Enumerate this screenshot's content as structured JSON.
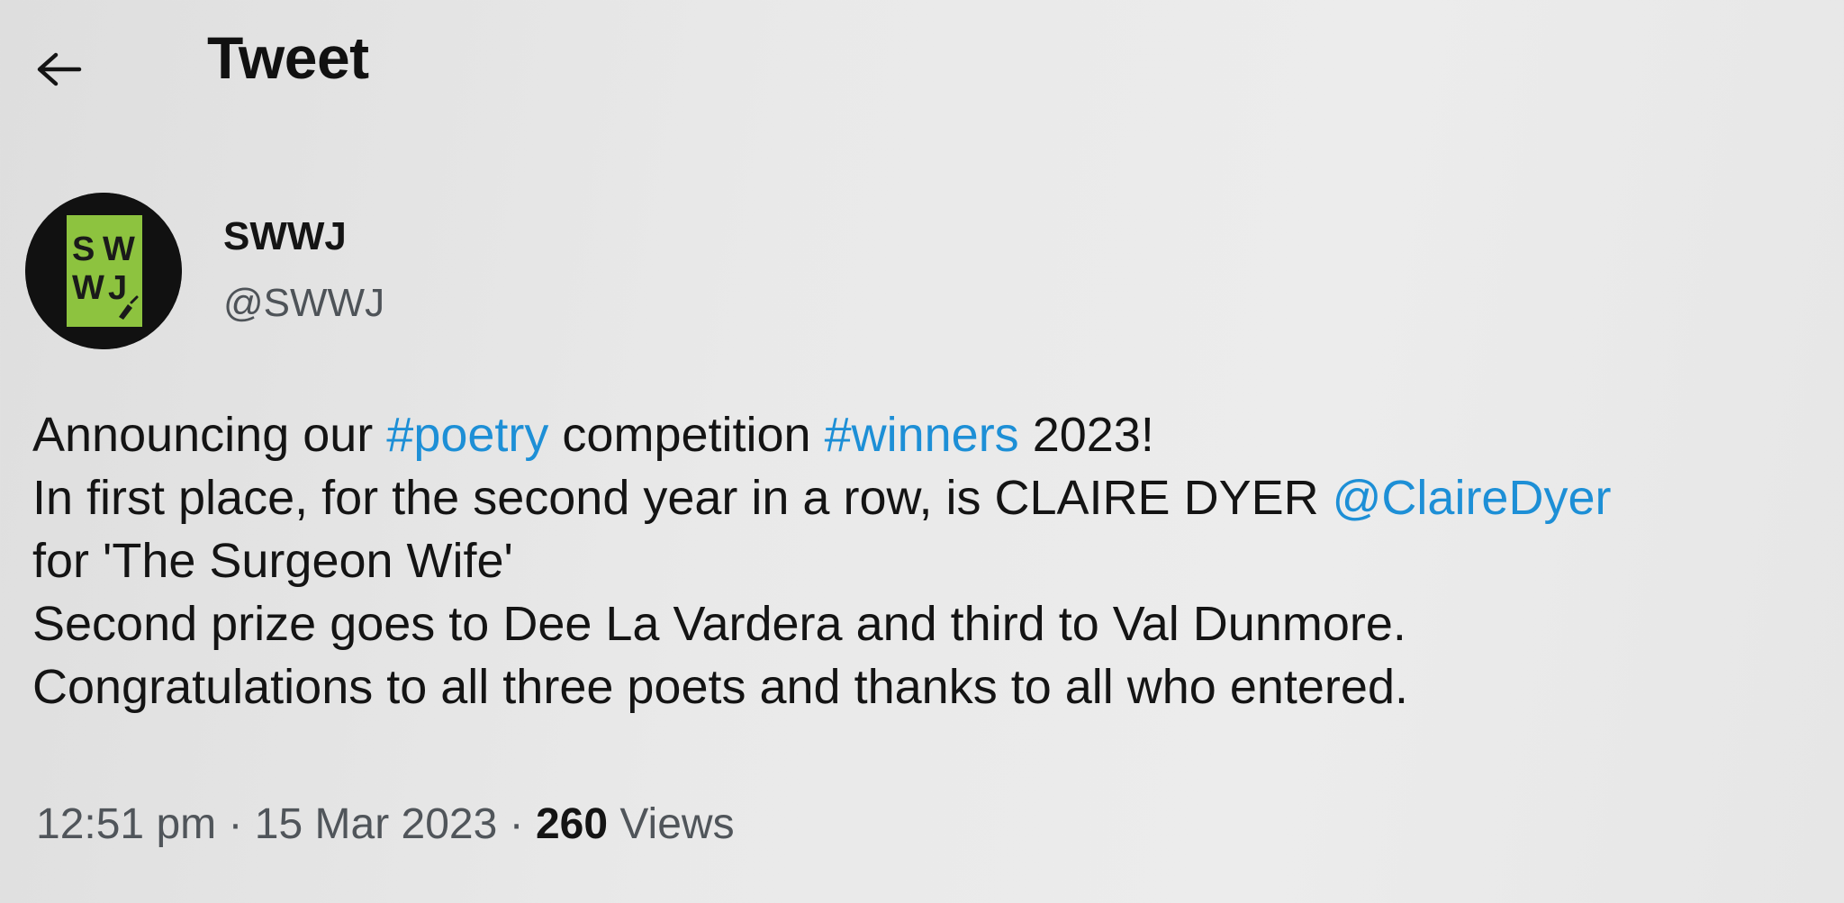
{
  "header": {
    "back_icon": "arrow-left-icon",
    "title": "Tweet"
  },
  "author": {
    "avatar_text": [
      "S",
      "W",
      "W",
      "J"
    ],
    "avatar_colors": {
      "background": "#111111",
      "tile": "#8dc33f",
      "letters": "#1a1a1a"
    },
    "display_name": "SWWJ",
    "handle": "@SWWJ"
  },
  "tweet": {
    "line1": {
      "t1": "Announcing our ",
      "tag1": "#poetry",
      "t2": " competition ",
      "tag2": "#winners",
      "t3": " 2023!"
    },
    "line2": {
      "t1": "In first place, for the second year in a row, is CLAIRE DYER ",
      "mention": "@ClaireDyer"
    },
    "line3": "for 'The Surgeon Wife'",
    "line4": "Second prize goes to Dee La Vardera  and third to Val Dunmore.",
    "line5": "Congratulations to all three poets and thanks to all who entered."
  },
  "meta": {
    "time": "12:51 pm",
    "sep1": " · ",
    "date": "15 Mar 2023",
    "sep2": " · ",
    "views_count": "260",
    "views_label": " Views"
  },
  "colors": {
    "link": "#1d8fd6",
    "text": "#141414",
    "secondary": "#50555a"
  }
}
